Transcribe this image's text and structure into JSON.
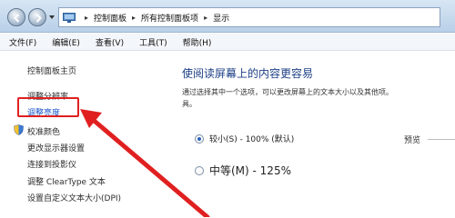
{
  "window": {
    "breadcrumbs": [
      "控制面板",
      "所有控制面板项",
      "显示"
    ]
  },
  "menu": {
    "items": [
      "文件(F)",
      "编辑(E)",
      "查看(V)",
      "工具(T)",
      "帮助(H)"
    ]
  },
  "sidebar": {
    "home": "控制面板主页",
    "items": [
      "调整分辨率",
      "调整亮度",
      "校准颜色",
      "更改显示器设置",
      "连接到投影仪",
      "调整 ClearType 文本",
      "设置自定义文本大小(DPI)"
    ]
  },
  "main": {
    "heading": "使阅读屏幕上的内容更容易",
    "description_line1": "通过选择其中一个选项，可以更改屏幕上的文本大小以及其他项。",
    "description_line2": "具。",
    "options": [
      {
        "label": "较小(S) - 100% (默认)",
        "selected": true
      },
      {
        "label": "中等(M) - 125%",
        "selected": false
      }
    ],
    "preview_label": "预览"
  },
  "annotation": {
    "color": "#e02020",
    "highlighted_item": "调整亮度"
  }
}
